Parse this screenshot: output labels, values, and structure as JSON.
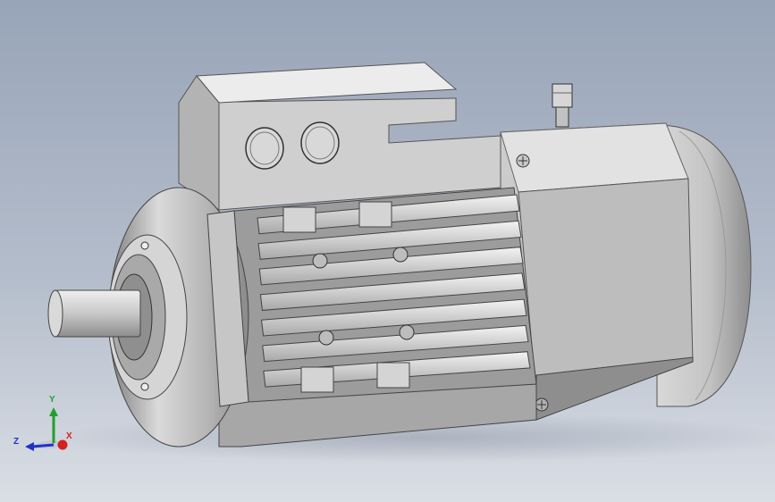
{
  "triad": {
    "x_label": "X",
    "y_label": "Y",
    "z_label": "Z",
    "colors": {
      "x": "#d42121",
      "y": "#1fa02c",
      "z": "#1f32c8"
    }
  },
  "colors": {
    "background_top": "#98a4b8",
    "background_bottom": "#dadee5",
    "body_light": "#e4e4e4",
    "body_mid": "#bcbcbc",
    "body_dark": "#7c7c7c"
  }
}
